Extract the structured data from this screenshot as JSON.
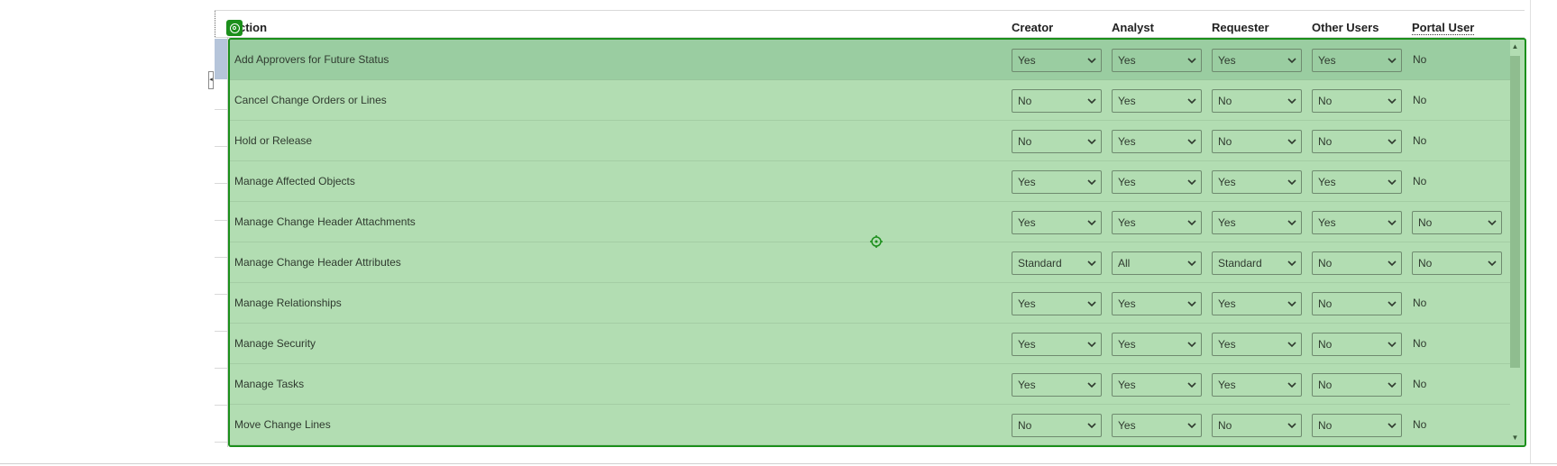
{
  "header": {
    "action": "ction",
    "creator": "Creator",
    "analyst": "Analyst",
    "requester": "Requester",
    "other_users": "Other Users",
    "portal_user": "Portal User"
  },
  "rows": [
    {
      "action": "Add Approvers for Future Status",
      "creator": "Yes",
      "analyst": "Yes",
      "requester": "Yes",
      "other_users": "Yes",
      "portal_user": "No",
      "portal_is_select": false
    },
    {
      "action": "Cancel Change Orders or Lines",
      "creator": "No",
      "analyst": "Yes",
      "requester": "No",
      "other_users": "No",
      "portal_user": "No",
      "portal_is_select": false
    },
    {
      "action": "Hold or Release",
      "creator": "No",
      "analyst": "Yes",
      "requester": "No",
      "other_users": "No",
      "portal_user": "No",
      "portal_is_select": false
    },
    {
      "action": "Manage Affected Objects",
      "creator": "Yes",
      "analyst": "Yes",
      "requester": "Yes",
      "other_users": "Yes",
      "portal_user": "No",
      "portal_is_select": false
    },
    {
      "action": "Manage Change Header Attachments",
      "creator": "Yes",
      "analyst": "Yes",
      "requester": "Yes",
      "other_users": "Yes",
      "portal_user": "No",
      "portal_is_select": true
    },
    {
      "action": "Manage Change Header Attributes",
      "creator": "Standard",
      "analyst": "All",
      "requester": "Standard",
      "other_users": "No",
      "portal_user": "No",
      "portal_is_select": true
    },
    {
      "action": "Manage Relationships",
      "creator": "Yes",
      "analyst": "Yes",
      "requester": "Yes",
      "other_users": "No",
      "portal_user": "No",
      "portal_is_select": false
    },
    {
      "action": "Manage Security",
      "creator": "Yes",
      "analyst": "Yes",
      "requester": "Yes",
      "other_users": "No",
      "portal_user": "No",
      "portal_is_select": false
    },
    {
      "action": "Manage Tasks",
      "creator": "Yes",
      "analyst": "Yes",
      "requester": "Yes",
      "other_users": "No",
      "portal_user": "No",
      "portal_is_select": false
    },
    {
      "action": "Move Change Lines",
      "creator": "No",
      "analyst": "Yes",
      "requester": "No",
      "other_users": "No",
      "portal_user": "No",
      "portal_is_select": false
    }
  ],
  "colors": {
    "overlay_fill": "#7ac47a",
    "overlay_border": "#1b8f1b",
    "selected_row_left": "#b6c5da"
  },
  "icons": {
    "overlay_badge": "target-icon",
    "center_marker": "crosshair-icon",
    "select_arrow": "chevron-down-icon",
    "collapse_handle": "collapse-arrow-icon"
  }
}
